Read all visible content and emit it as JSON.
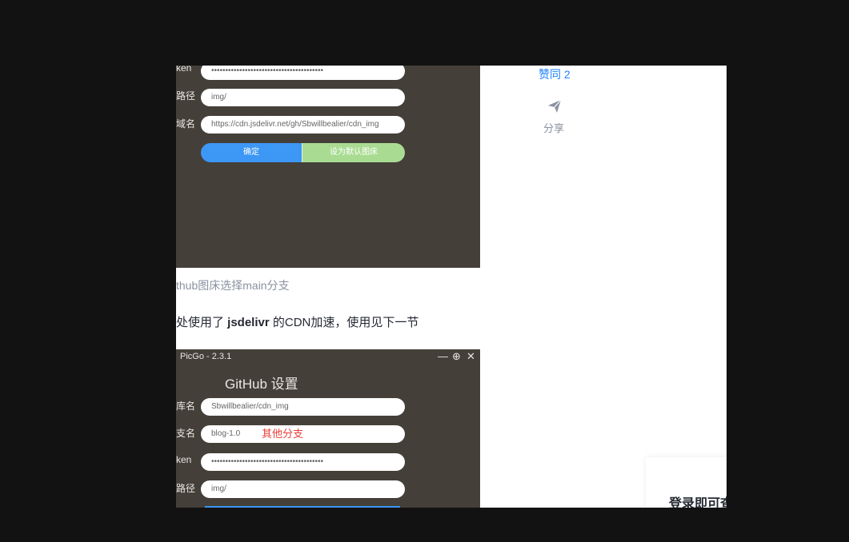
{
  "shot1": {
    "labels": [
      "ken",
      "路径",
      "域名"
    ],
    "token_value": "••••••••••••••••••••••••••••••••••••••••",
    "path_value": "img/",
    "domain_value": "https://cdn.jsdelivr.net/gh/Sbwillbealier/cdn_img",
    "confirm_label": "确定",
    "default_label": "设为默认图床"
  },
  "sidebar": {
    "like_label": "赞同 2",
    "share_label": "分享"
  },
  "caption": "thub图床选择main分支",
  "paragraph": {
    "prefix": "处使用了 ",
    "bold": "jsdelivr",
    "suffix": " 的CDN加速，使用见下一节"
  },
  "shot2": {
    "window_title": "PicGo - 2.3.1",
    "heading": "GitHub 设置",
    "labels": [
      "库名",
      "支名",
      "ken",
      "路径"
    ],
    "repo_value": "Sbwillbealier/cdn_img",
    "branch_value": "blog-1.0",
    "branch_note": "其他分支",
    "token_value": "••••••••••••••••••••••••••••••••••••••••",
    "path_value": "img/",
    "controls": [
      "—",
      "⊕",
      "✕"
    ]
  },
  "login_card": {
    "text": "登录即可查"
  },
  "colors": {
    "page_bg": "#121212",
    "panel_bg": "#443f39",
    "accent_blue": "#1e80ff",
    "confirm_blue": "#3d97f5",
    "default_green": "#a9dc92",
    "note_red": "#e8403a"
  },
  "icons": [
    "send-icon"
  ]
}
